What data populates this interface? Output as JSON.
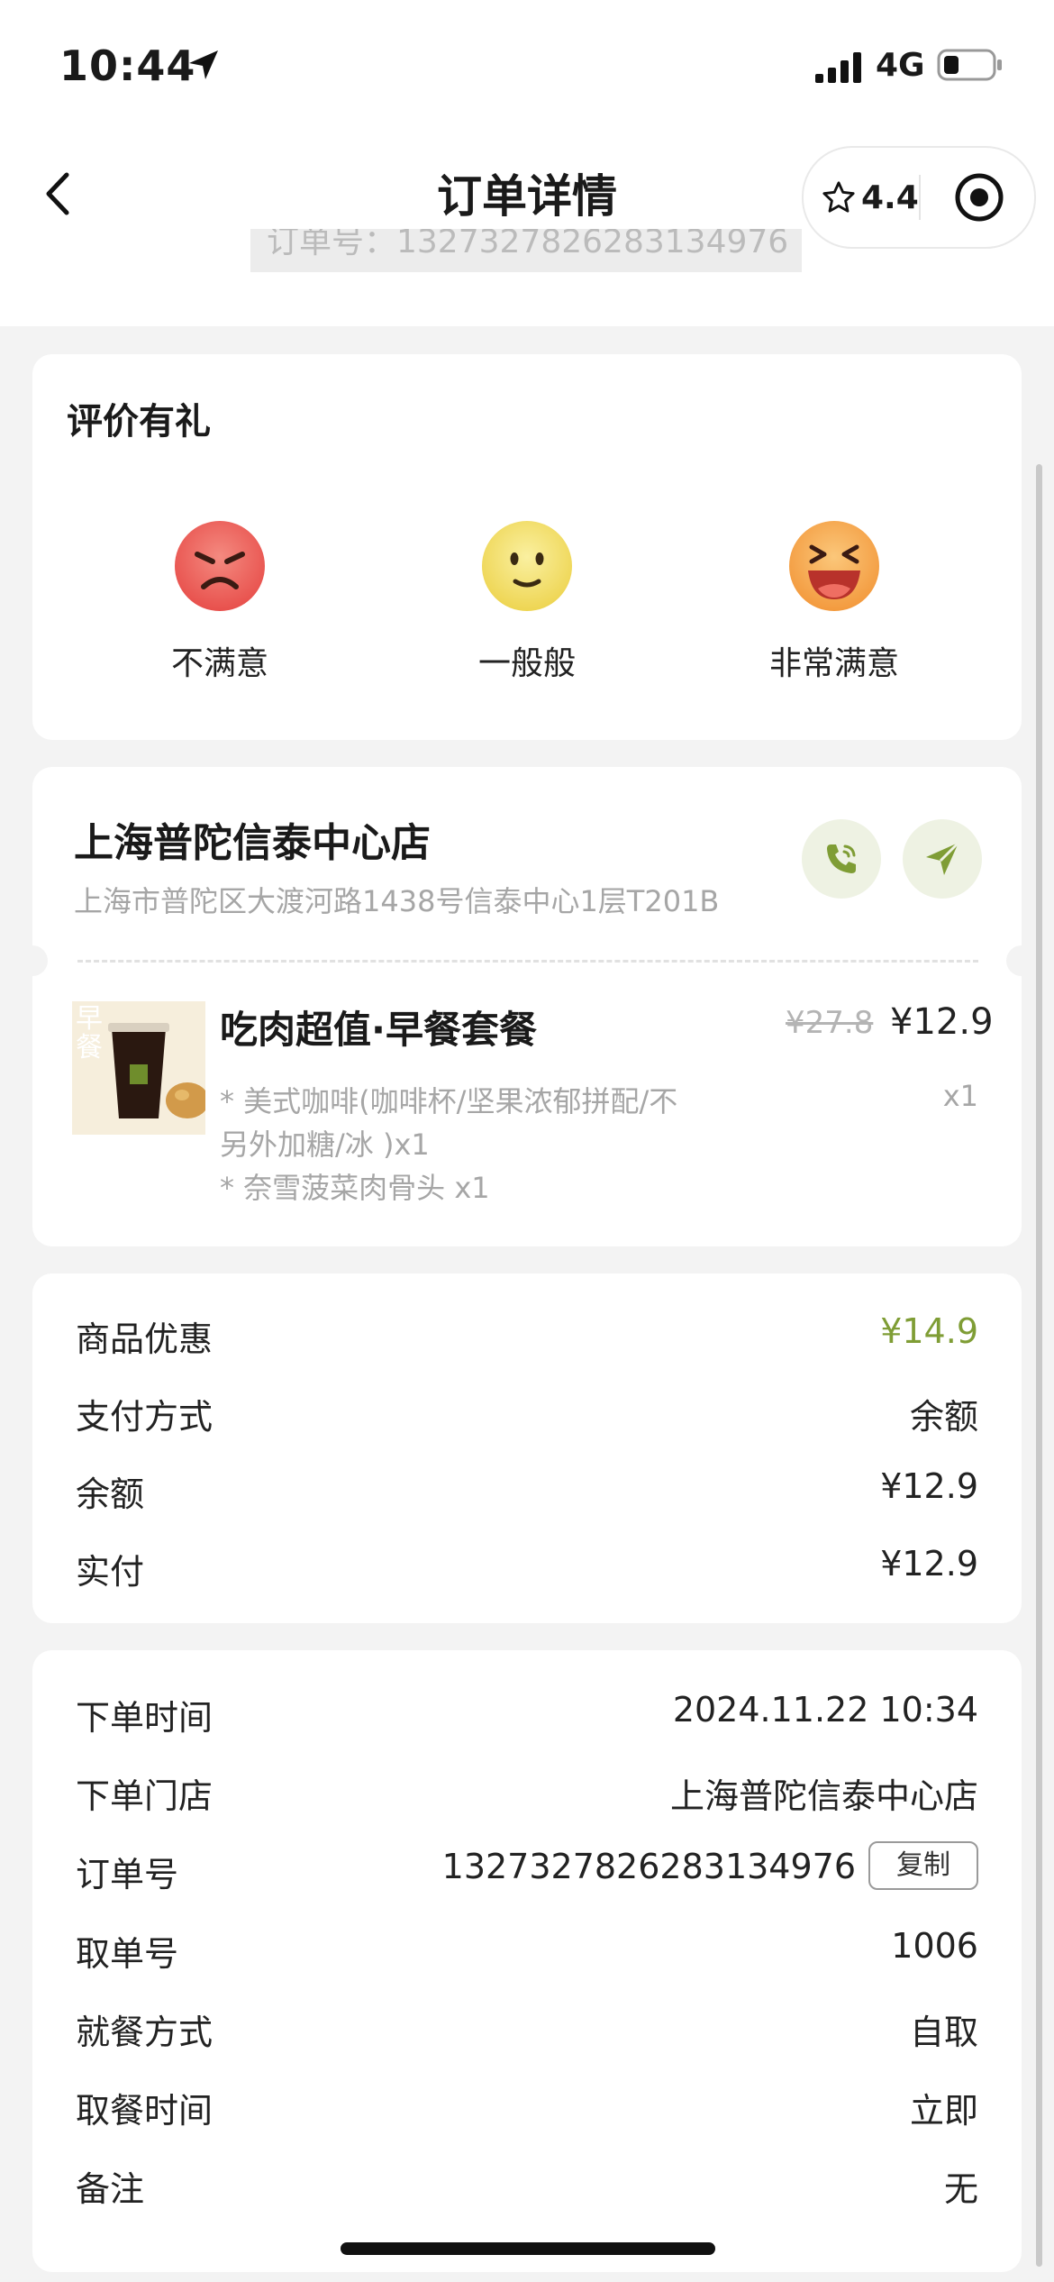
{
  "status_bar": {
    "time": "10:44",
    "network": "4G"
  },
  "nav": {
    "title": "订单详情",
    "rating": "4.4",
    "order_number_overlay": "订单号：1327327826283134976"
  },
  "rating_card": {
    "title": "评价有礼",
    "options": [
      {
        "label": "不满意",
        "icon": "angry-face-icon",
        "color": "#ec5a55"
      },
      {
        "label": "一般般",
        "icon": "neutral-face-icon",
        "color": "#f2dc62"
      },
      {
        "label": "非常满意",
        "icon": "laughing-face-icon",
        "color": "#f6a64a"
      }
    ]
  },
  "store": {
    "name": "上海普陀信泰中心店",
    "address": "上海市普陀区大渡河路1438号信泰中心1层T201B",
    "product": {
      "thumb_text": "早餐",
      "name": "吃肉超值·早餐套餐",
      "original_price": "¥27.8",
      "price": "¥12.9",
      "quantity": "x1",
      "specs": [
        "* 美式咖啡(咖啡杯/坚果浓郁拼配/不",
        "另外加糖/冰 )x1",
        "* 奈雪菠菜肉骨头 x1"
      ]
    }
  },
  "payment": {
    "rows": [
      {
        "label": "商品优惠",
        "value": "¥14.9"
      },
      {
        "label": "支付方式",
        "value": "余额"
      },
      {
        "label": "余额",
        "value": "¥12.9"
      },
      {
        "label": "实付",
        "value": "¥12.9"
      }
    ]
  },
  "order_info": {
    "rows": [
      {
        "label": "下单时间",
        "value": "2024.11.22 10:34"
      },
      {
        "label": "下单门店",
        "value": "上海普陀信泰中心店"
      },
      {
        "label": "订单号",
        "value": "1327327826283134976"
      },
      {
        "label": "取单号",
        "value": "1006"
      },
      {
        "label": "就餐方式",
        "value": "自取"
      },
      {
        "label": "取餐时间",
        "value": "立即"
      },
      {
        "label": "备注",
        "value": "无"
      }
    ],
    "copy_label": "复制"
  },
  "colors": {
    "accent_green": "#7f9d35",
    "button_bg": "#eef2e3",
    "icon_green": "#7f9d35"
  }
}
